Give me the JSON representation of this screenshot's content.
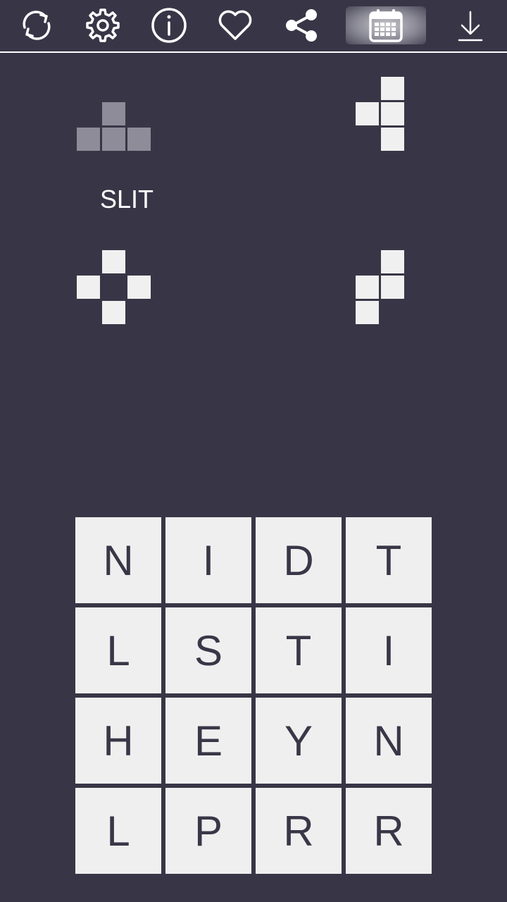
{
  "toolbar": {
    "buttons": [
      {
        "name": "refresh-icon",
        "active": false
      },
      {
        "name": "gear-icon",
        "active": false
      },
      {
        "name": "info-icon",
        "active": false
      },
      {
        "name": "heart-icon",
        "active": false
      },
      {
        "name": "share-icon",
        "active": false
      },
      {
        "name": "calendar-icon",
        "active": true
      },
      {
        "name": "download-icon",
        "active": false
      }
    ]
  },
  "found_word": "SLIT",
  "colors": {
    "background": "#383646",
    "tile": "#efefef",
    "tile_text": "#393747",
    "found_piece": "#8d8c98",
    "unfound_piece": "#f0f0f0"
  },
  "pieces": [
    {
      "id": "t-shape",
      "found": true,
      "cells": [
        [
          0,
          1
        ],
        [
          1,
          0
        ],
        [
          1,
          1
        ],
        [
          1,
          2
        ]
      ]
    },
    {
      "id": "t-shape-left",
      "found": false,
      "cells": [
        [
          0,
          1
        ],
        [
          1,
          0
        ],
        [
          1,
          1
        ],
        [
          2,
          1
        ]
      ]
    },
    {
      "id": "ring",
      "found": false,
      "cells": [
        [
          0,
          1
        ],
        [
          1,
          0
        ],
        [
          1,
          2
        ],
        [
          2,
          1
        ]
      ]
    },
    {
      "id": "s-shape",
      "found": false,
      "cells": [
        [
          0,
          1
        ],
        [
          1,
          0
        ],
        [
          1,
          1
        ],
        [
          2,
          0
        ]
      ]
    }
  ],
  "board": [
    [
      "N",
      "I",
      "D",
      "T"
    ],
    [
      "L",
      "S",
      "T",
      "I"
    ],
    [
      "H",
      "E",
      "Y",
      "N"
    ],
    [
      "L",
      "P",
      "R",
      "R"
    ]
  ]
}
